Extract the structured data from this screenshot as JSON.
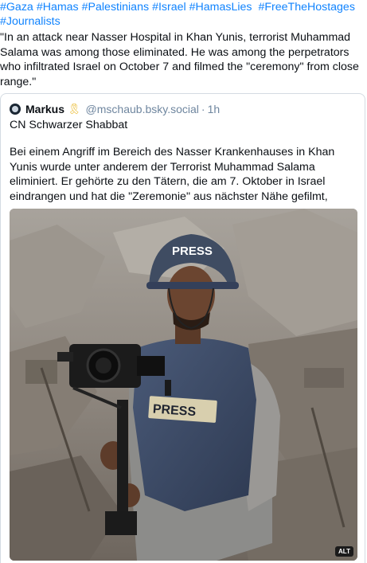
{
  "hashtags": [
    "#Gaza",
    "#Hamas",
    "#Palestinians",
    "#Israel",
    "#HamasLies",
    "#FreeTheHostages",
    "#Journalists"
  ],
  "post_text": "\"In an attack near Nasser Hospital in Khan Yunis, terrorist Muhammad Salama was among those eliminated. He was among the perpetrators who infiltrated Israel on October 7 and filmed the \"ceremony\" from close range.\"",
  "quote": {
    "author_name": "Markus",
    "ribbon_icon": "yellow-ribbon-icon",
    "handle": "@mschaub.bsky.social",
    "separator": "·",
    "time": "1h",
    "line1": "CN Schwarzer Shabbat",
    "body": "Bei einem Angriff im Bereich des Nasser Krankenhauses in Khan Yunis wurde unter anderem der Terrorist Muhammad Salama eliminiert. Er gehörte zu den Tätern, die am 7. Oktober in Israel eindrangen und hat die \"Zeremonie\" aus nächster Nähe gefilmt,"
  },
  "image": {
    "helmet_label": "PRESS",
    "vest_label": "PRESS",
    "alt_badge": "ALT"
  },
  "colors": {
    "link": "#1083fe",
    "muted": "#6f869f",
    "border": "#d4dbe2"
  }
}
